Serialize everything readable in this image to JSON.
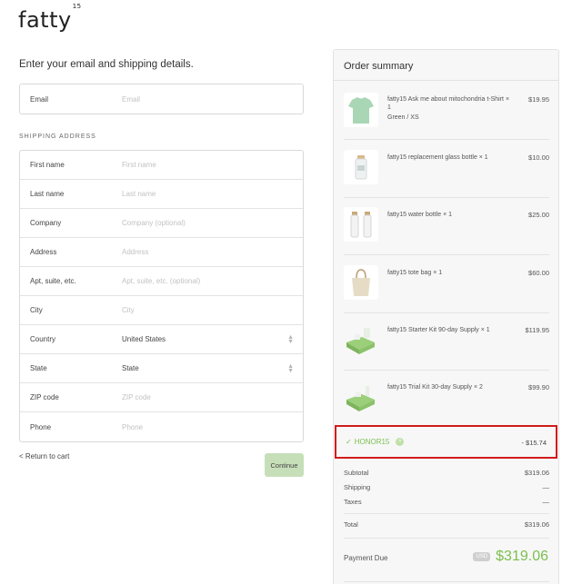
{
  "brand": {
    "logo_text": "fatty",
    "logo_sup": "15"
  },
  "form": {
    "lead": "Enter your email and shipping details.",
    "email": {
      "label": "Email",
      "placeholder": "Email"
    },
    "shipping_heading": "SHIPPING ADDRESS",
    "fields": [
      {
        "label": "First name",
        "placeholder": "First name",
        "value": ""
      },
      {
        "label": "Last name",
        "placeholder": "Last name",
        "value": ""
      },
      {
        "label": "Company",
        "placeholder": "Company (optional)",
        "value": ""
      },
      {
        "label": "Address",
        "placeholder": "Address",
        "value": ""
      },
      {
        "label": "Apt, suite, etc.",
        "placeholder": "Apt, suite, etc. (optional)",
        "value": ""
      },
      {
        "label": "City",
        "placeholder": "City",
        "value": ""
      },
      {
        "label": "Country",
        "placeholder": "",
        "value": "United States"
      },
      {
        "label": "State",
        "placeholder": "",
        "value": "State"
      },
      {
        "label": "ZIP code",
        "placeholder": "ZIP code",
        "value": ""
      },
      {
        "label": "Phone",
        "placeholder": "Phone",
        "value": ""
      }
    ],
    "return_link": "< Return to cart",
    "continue_label": "Continue"
  },
  "summary": {
    "title": "Order summary",
    "items": [
      {
        "name": "fatty15 Ask me about mitochondria t-Shirt × 1",
        "variant": "Green / XS",
        "price": "$19.95",
        "thumb_icon": "tshirt-icon"
      },
      {
        "name": "fatty15 replacement glass bottle × 1",
        "variant": "",
        "price": "$10.00",
        "thumb_icon": "glass-bottle-icon"
      },
      {
        "name": "fatty15 water bottle × 1",
        "variant": "",
        "price": "$25.00",
        "thumb_icon": "water-bottle-icon"
      },
      {
        "name": "fatty15 tote bag × 1",
        "variant": "",
        "price": "$60.00",
        "thumb_icon": "tote-bag-icon"
      },
      {
        "name": "fatty15 Starter Kit 90-day Supply × 1",
        "variant": "",
        "price": "$119.95",
        "thumb_icon": "starter-kit-icon"
      },
      {
        "name": "fatty15 Trial Kit 30-day Supply × 2",
        "variant": "",
        "price": "$99.90",
        "thumb_icon": "trial-kit-icon"
      }
    ],
    "discount": {
      "check": "✓",
      "code": "HONOR15",
      "remove": "×",
      "amount": "- $15.74"
    },
    "totals": {
      "subtotal_label": "Subtotal",
      "subtotal": "$319.06",
      "shipping_label": "Shipping",
      "shipping": "—",
      "taxes_label": "Taxes",
      "taxes": "—",
      "total_label": "Total",
      "total": "$319.06"
    },
    "payment_due_label": "Payment Due",
    "currency": "USD",
    "payment_due": "$319.06",
    "colors": {
      "accent_green": "#7cbf4f",
      "highlight_red": "#d11b1b"
    }
  }
}
